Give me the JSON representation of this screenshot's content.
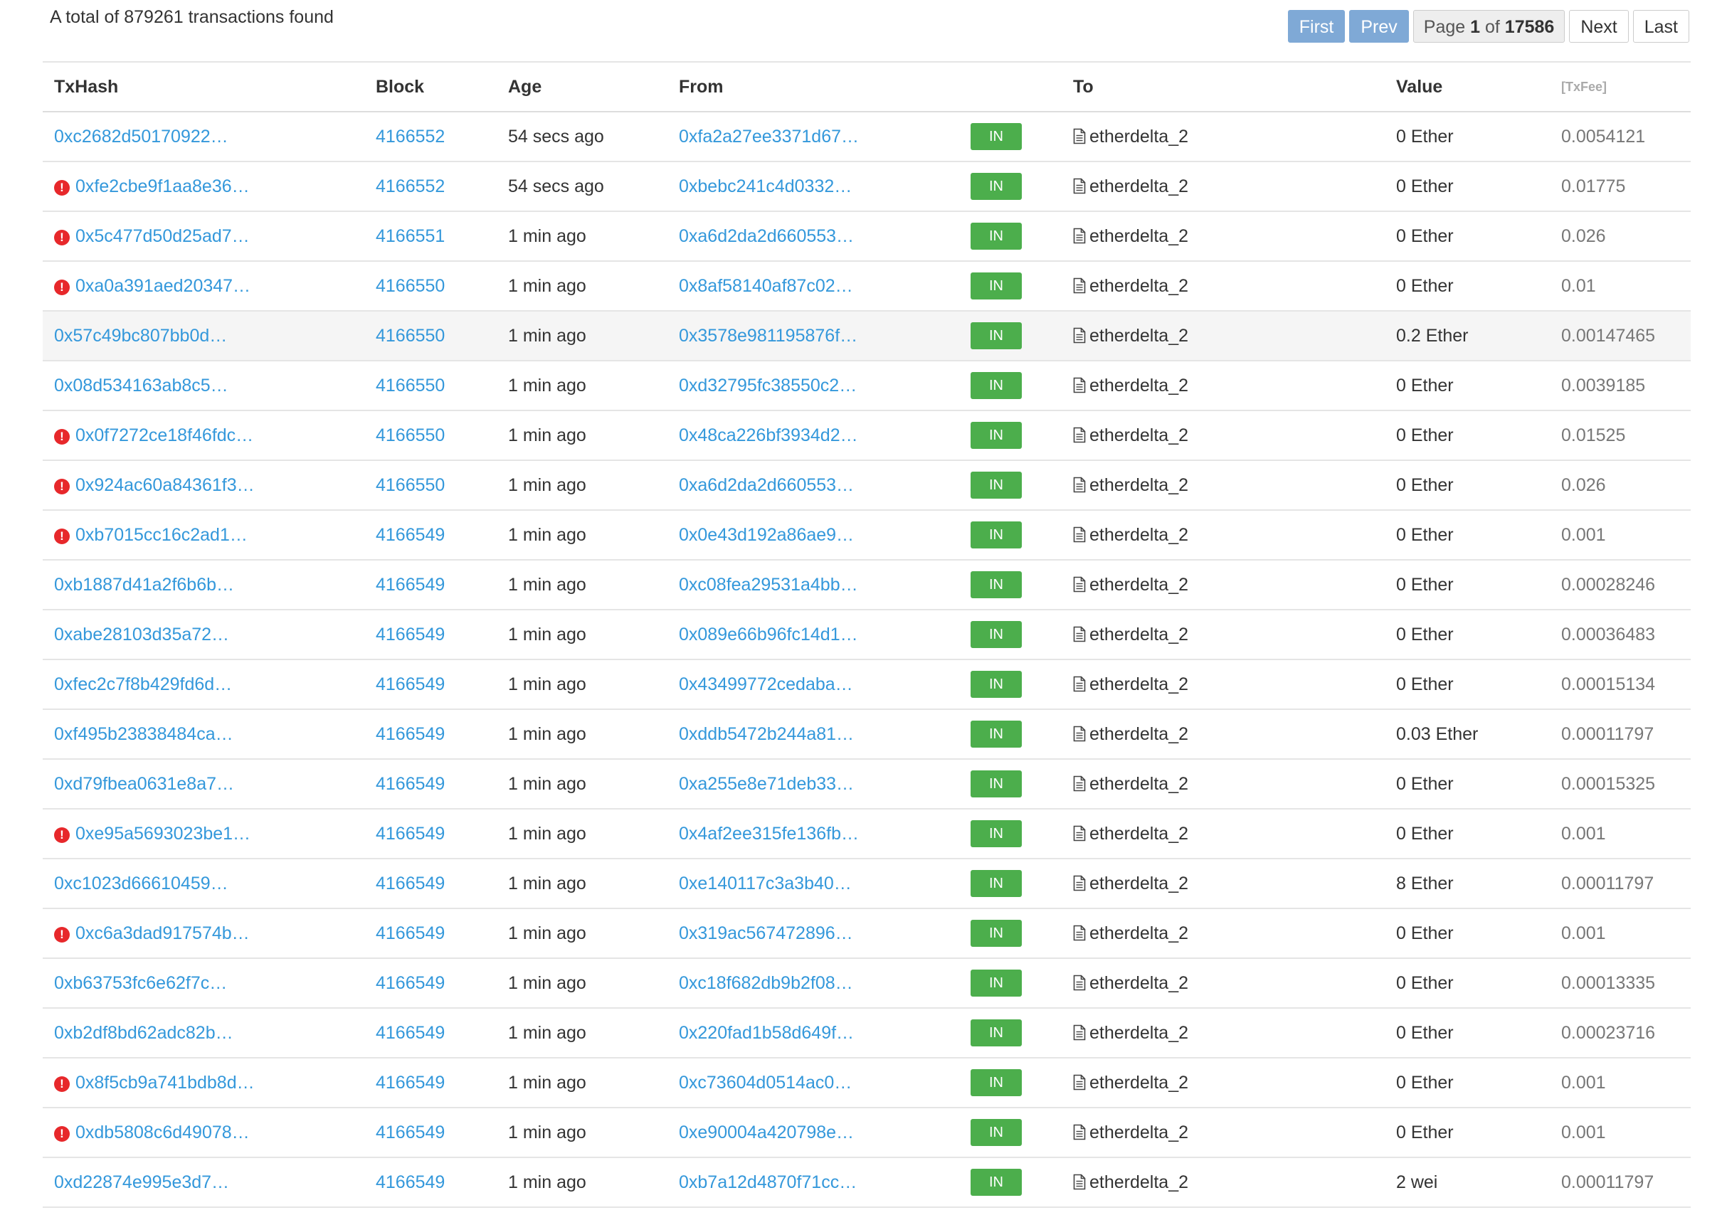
{
  "summary": "A total of 879261 transactions found",
  "pager": {
    "first": "First",
    "prev": "Prev",
    "page_word": "Page",
    "current": "1",
    "of_word": "of",
    "total": "17586",
    "next": "Next",
    "last": "Last"
  },
  "headers": {
    "txhash": "TxHash",
    "block": "Block",
    "age": "Age",
    "from": "From",
    "to": "To",
    "value": "Value",
    "txfee": "[TxFee]"
  },
  "direction_label": "IN",
  "colors": {
    "link": "#3498db",
    "in_badge": "#4cae4c",
    "error": "#e7282b",
    "pager_disabled": "#7fa9d6"
  },
  "rows": [
    {
      "hash": "0xc2682d50170922…",
      "err": false,
      "block": "4166552",
      "age": "54 secs ago",
      "from": "0xfa2a27ee3371d67…",
      "to": "etherdelta_2",
      "value": "0 Ether",
      "fee": "0.0054121"
    },
    {
      "hash": "0xfe2cbe9f1aa8e36…",
      "err": true,
      "block": "4166552",
      "age": "54 secs ago",
      "from": "0xbebc241c4d0332…",
      "to": "etherdelta_2",
      "value": "0 Ether",
      "fee": "0.01775"
    },
    {
      "hash": "0x5c477d50d25ad7…",
      "err": true,
      "block": "4166551",
      "age": "1 min ago",
      "from": "0xa6d2da2d660553…",
      "to": "etherdelta_2",
      "value": "0 Ether",
      "fee": "0.026"
    },
    {
      "hash": "0xa0a391aed20347…",
      "err": true,
      "block": "4166550",
      "age": "1 min ago",
      "from": "0x8af58140af87c02…",
      "to": "etherdelta_2",
      "value": "0 Ether",
      "fee": "0.01"
    },
    {
      "hash": "0x57c49bc807bb0d…",
      "err": false,
      "block": "4166550",
      "age": "1 min ago",
      "from": "0x3578e981195876f…",
      "to": "etherdelta_2",
      "value": "0.2 Ether",
      "fee": "0.00147465",
      "highlight": true
    },
    {
      "hash": "0x08d534163ab8c5…",
      "err": false,
      "block": "4166550",
      "age": "1 min ago",
      "from": "0xd32795fc38550c2…",
      "to": "etherdelta_2",
      "value": "0 Ether",
      "fee": "0.0039185"
    },
    {
      "hash": "0x0f7272ce18f46fdc…",
      "err": true,
      "block": "4166550",
      "age": "1 min ago",
      "from": "0x48ca226bf3934d2…",
      "to": "etherdelta_2",
      "value": "0 Ether",
      "fee": "0.01525"
    },
    {
      "hash": "0x924ac60a84361f3…",
      "err": true,
      "block": "4166550",
      "age": "1 min ago",
      "from": "0xa6d2da2d660553…",
      "to": "etherdelta_2",
      "value": "0 Ether",
      "fee": "0.026"
    },
    {
      "hash": "0xb7015cc16c2ad1…",
      "err": true,
      "block": "4166549",
      "age": "1 min ago",
      "from": "0x0e43d192a86ae9…",
      "to": "etherdelta_2",
      "value": "0 Ether",
      "fee": "0.001"
    },
    {
      "hash": "0xb1887d41a2f6b6b…",
      "err": false,
      "block": "4166549",
      "age": "1 min ago",
      "from": "0xc08fea29531a4bb…",
      "to": "etherdelta_2",
      "value": "0 Ether",
      "fee": "0.00028246"
    },
    {
      "hash": "0xabe28103d35a72…",
      "err": false,
      "block": "4166549",
      "age": "1 min ago",
      "from": "0x089e66b96fc14d1…",
      "to": "etherdelta_2",
      "value": "0 Ether",
      "fee": "0.00036483"
    },
    {
      "hash": "0xfec2c7f8b429fd6d…",
      "err": false,
      "block": "4166549",
      "age": "1 min ago",
      "from": "0x43499772cedaba…",
      "to": "etherdelta_2",
      "value": "0 Ether",
      "fee": "0.00015134"
    },
    {
      "hash": "0xf495b23838484ca…",
      "err": false,
      "block": "4166549",
      "age": "1 min ago",
      "from": "0xddb5472b244a81…",
      "to": "etherdelta_2",
      "value": "0.03 Ether",
      "fee": "0.00011797"
    },
    {
      "hash": "0xd79fbea0631e8a7…",
      "err": false,
      "block": "4166549",
      "age": "1 min ago",
      "from": "0xa255e8e71deb33…",
      "to": "etherdelta_2",
      "value": "0 Ether",
      "fee": "0.00015325"
    },
    {
      "hash": "0xe95a5693023be1…",
      "err": true,
      "block": "4166549",
      "age": "1 min ago",
      "from": "0x4af2ee315fe136fb…",
      "to": "etherdelta_2",
      "value": "0 Ether",
      "fee": "0.001"
    },
    {
      "hash": "0xc1023d66610459…",
      "err": false,
      "block": "4166549",
      "age": "1 min ago",
      "from": "0xe140117c3a3b40…",
      "to": "etherdelta_2",
      "value": "8 Ether",
      "fee": "0.00011797"
    },
    {
      "hash": "0xc6a3dad917574b…",
      "err": true,
      "block": "4166549",
      "age": "1 min ago",
      "from": "0x319ac567472896…",
      "to": "etherdelta_2",
      "value": "0 Ether",
      "fee": "0.001"
    },
    {
      "hash": "0xb63753fc6e62f7c…",
      "err": false,
      "block": "4166549",
      "age": "1 min ago",
      "from": "0xc18f682db9b2f08…",
      "to": "etherdelta_2",
      "value": "0 Ether",
      "fee": "0.00013335"
    },
    {
      "hash": "0xb2df8bd62adc82b…",
      "err": false,
      "block": "4166549",
      "age": "1 min ago",
      "from": "0x220fad1b58d649f…",
      "to": "etherdelta_2",
      "value": "0 Ether",
      "fee": "0.00023716"
    },
    {
      "hash": "0x8f5cb9a741bdb8d…",
      "err": true,
      "block": "4166549",
      "age": "1 min ago",
      "from": "0xc73604d0514ac0…",
      "to": "etherdelta_2",
      "value": "0 Ether",
      "fee": "0.001"
    },
    {
      "hash": "0xdb5808c6d49078…",
      "err": true,
      "block": "4166549",
      "age": "1 min ago",
      "from": "0xe90004a420798e…",
      "to": "etherdelta_2",
      "value": "0 Ether",
      "fee": "0.001"
    },
    {
      "hash": "0xd22874e995e3d7…",
      "err": false,
      "block": "4166549",
      "age": "1 min ago",
      "from": "0xb7a12d4870f71cc…",
      "to": "etherdelta_2",
      "value": "2 wei",
      "fee": "0.00011797"
    }
  ]
}
